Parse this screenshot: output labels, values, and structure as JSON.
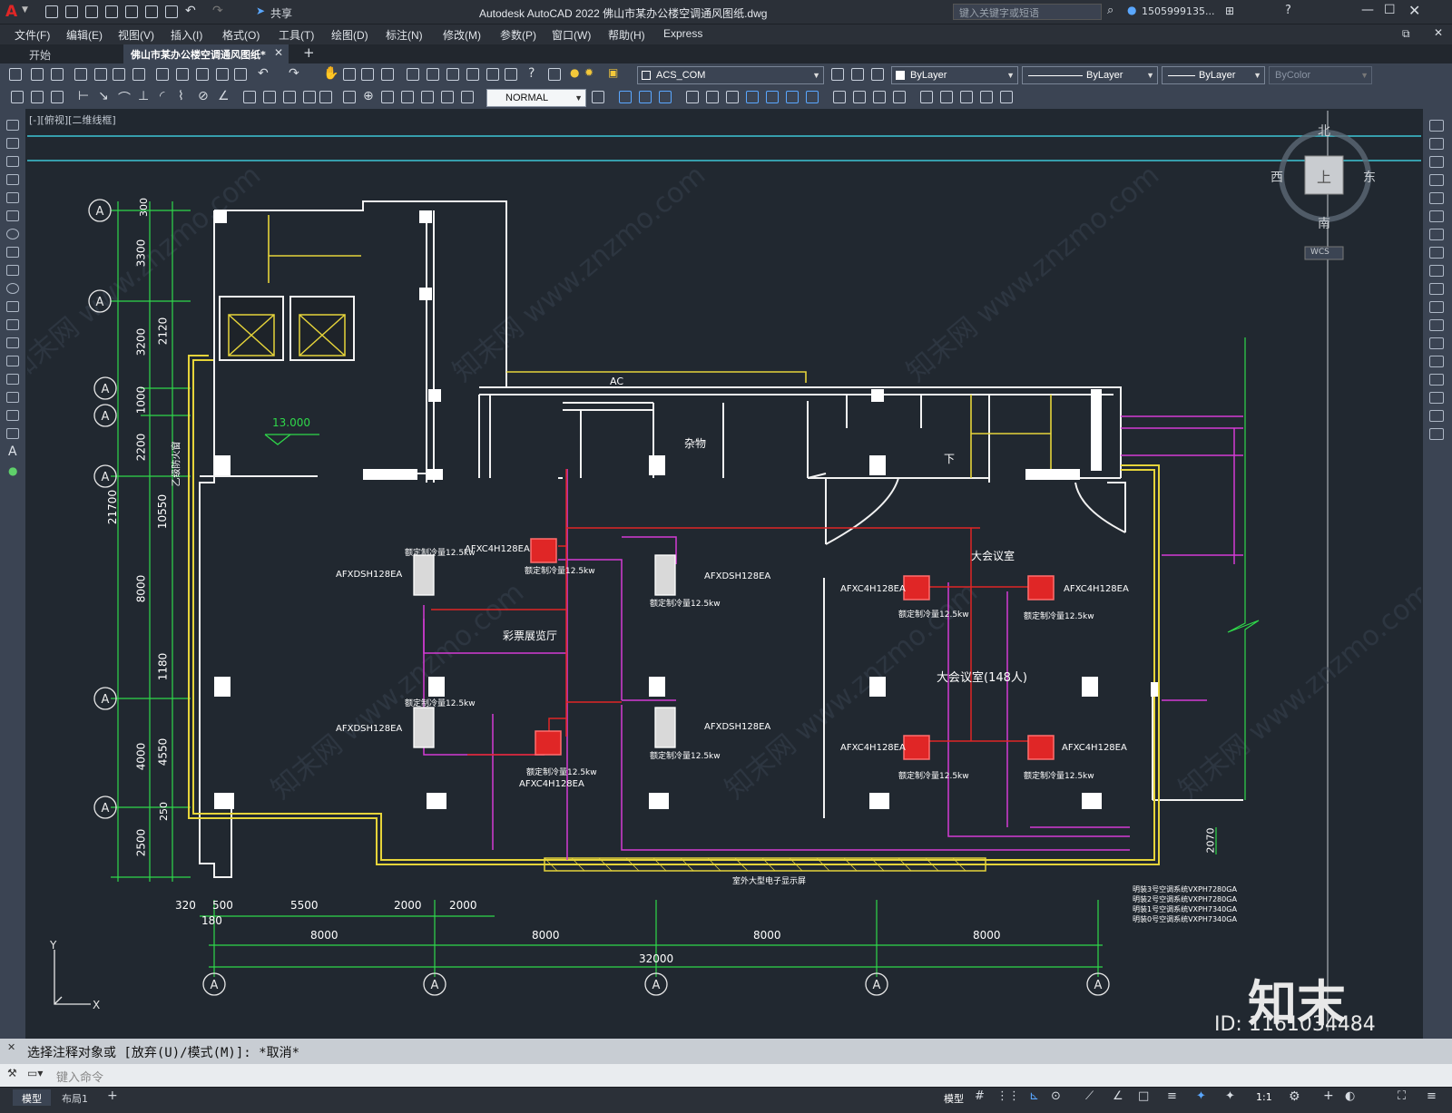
{
  "app": {
    "window_title": "Autodesk AutoCAD 2022    佛山市某办公楼空调通风图纸.dwg",
    "search_placeholder": "键入关键字或短语",
    "user": "1505999135...",
    "share": "共享"
  },
  "menu": [
    "文件(F)",
    "编辑(E)",
    "视图(V)",
    "插入(I)",
    "格式(O)",
    "工具(T)",
    "绘图(D)",
    "标注(N)",
    "修改(M)",
    "参数(P)",
    "窗口(W)",
    "帮助(H)",
    "Express"
  ],
  "tabs": [
    {
      "label": "开始",
      "active": false
    },
    {
      "label": "佛山市某办公楼空调通风图纸*",
      "active": true
    }
  ],
  "toolbar": {
    "layer": "ACS_COM",
    "color": "ByLayer",
    "linetype": "ByLayer",
    "lineweight": "ByLayer",
    "plotstyle": "ByColor",
    "dimstyle": "NORMAL"
  },
  "viewport": {
    "label": "[-][俯视][二维线框]",
    "viewcube": {
      "north": "北",
      "south": "南",
      "east": "东",
      "west": "西",
      "face": "上",
      "wcs": "WCS"
    }
  },
  "drawing": {
    "elevation": "13.000",
    "left_dims": [
      "300",
      "3300",
      "3200",
      "1000",
      "2200",
      "8000",
      "4000",
      "2500"
    ],
    "left_dims2": [
      "2120",
      "10550",
      "1180",
      "4550",
      "250"
    ],
    "total_height": "21700",
    "stair_label": "乙级防火窗",
    "bottom_small": [
      "320",
      "500",
      "180",
      "5500",
      "2000",
      "2000"
    ],
    "bottom_bays": [
      "8000",
      "8000",
      "8000",
      "8000"
    ],
    "total_width": "32000",
    "right_dim": "2070",
    "room_storage": "杂物",
    "room_down": "下",
    "room_ac": "AC",
    "room_hall": "彩票展览厅",
    "room_meeting": "大会议室",
    "room_meeting_cap": "大会议室(148人)",
    "display_label": "室外大型电子显示屏",
    "units": [
      {
        "model": "AFXDSH128EA",
        "power": "额定制冷量12.5kw"
      },
      {
        "model": "AFXC4H128EA",
        "power": "额定制冷量12.5kw"
      }
    ],
    "legend": [
      "明装3号空调系统VXPH7280GA",
      "明装2号空调系统VXPH7280GA",
      "明装1号空调系统VXPH7340GA",
      "明装0号空调系统VXPH7340GA"
    ],
    "watermark": "知末网 www.znzmo.com",
    "logo": "知末",
    "id_text": "ID: 1161034484"
  },
  "command": {
    "history": "选择注释对象或 [放弃(U)/模式(M)]: *取消*",
    "placeholder": "键入命令"
  },
  "status": {
    "tabs": [
      "模型",
      "布局1"
    ],
    "model_btn": "模型",
    "scale": "1:1"
  }
}
